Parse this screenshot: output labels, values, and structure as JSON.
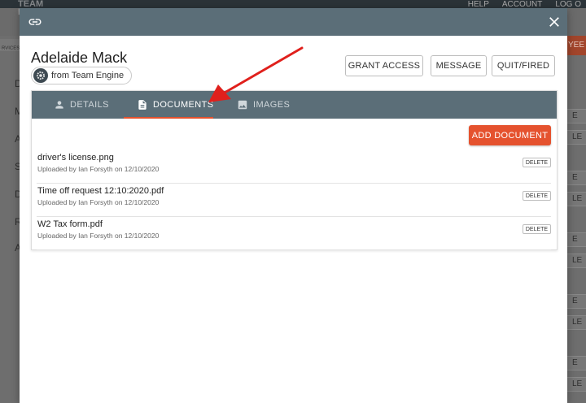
{
  "background": {
    "logo_text": "TEAM ENGINE",
    "topnav": [
      "HELP",
      "ACCOUNT",
      "LOG O"
    ],
    "sidebar_letters": [
      "D",
      "M",
      "A",
      "S",
      "D",
      "R",
      "A"
    ],
    "side_buttons": [
      "E",
      "LE",
      "E",
      "LE",
      "E",
      "LE",
      "E",
      "LE",
      "E",
      "LE",
      "E"
    ],
    "right_tab_label": "YEE",
    "sub_left_label": "RVICES"
  },
  "modal": {
    "person_name": "Adelaide Mack",
    "source_label": "from Team Engine",
    "actions": {
      "grant_access": "GRANT ACCESS",
      "message": "MESSAGE",
      "quit_fired": "QUIT/FIRED"
    },
    "tabs": [
      {
        "label": "DETAILS",
        "icon": "person-icon"
      },
      {
        "label": "DOCUMENTS",
        "icon": "document-icon",
        "active": true
      },
      {
        "label": "IMAGES",
        "icon": "image-icon"
      }
    ],
    "add_document_label": "ADD DOCUMENT",
    "documents": [
      {
        "name": "driver's license.png",
        "meta": "Uploaded by Ian Forsyth on 12/10/2020",
        "delete_label": "DELETE"
      },
      {
        "name": "Time off request 12:10:2020.pdf",
        "meta": "Uploaded by Ian Forsyth on 12/10/2020",
        "delete_label": "DELETE"
      },
      {
        "name": "W2 Tax form.pdf",
        "meta": "Uploaded by Ian Forsyth on 12/10/2020",
        "delete_label": "DELETE"
      }
    ]
  },
  "colors": {
    "header": "#5b6e78",
    "accent": "#e5522e",
    "annotation_arrow": "#e0201c"
  }
}
